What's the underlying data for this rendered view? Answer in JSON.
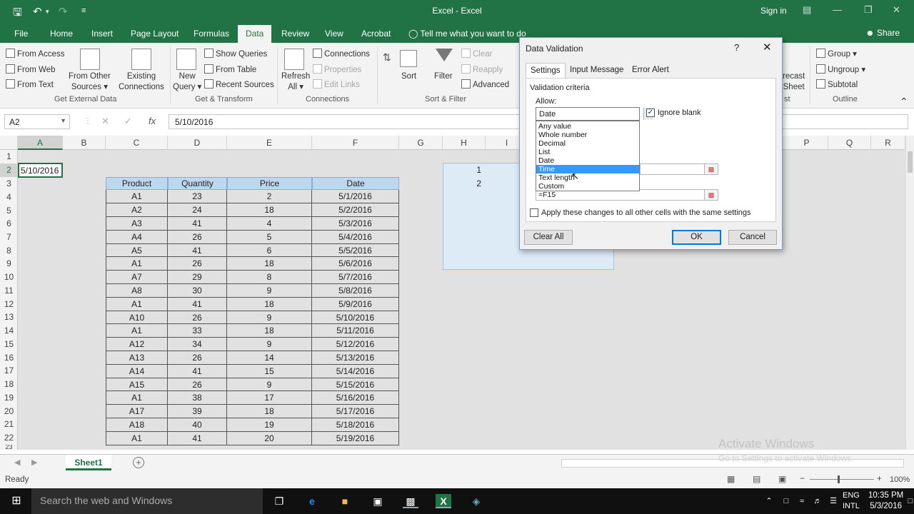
{
  "window": {
    "title": "Excel - Excel",
    "sign_in": "Sign in"
  },
  "ribbon_tabs": [
    "File",
    "Home",
    "Insert",
    "Page Layout",
    "Formulas",
    "Data",
    "Review",
    "View",
    "Acrobat"
  ],
  "tell_me": "Tell me what you want to do",
  "share": "Share",
  "ribbon": {
    "get_external": {
      "from_access": "From Access",
      "from_web": "From Web",
      "from_text": "From Text",
      "from_other": "From Other",
      "from_other_2": "Sources",
      "existing": "Existing",
      "existing_2": "Connections",
      "label": "Get External Data"
    },
    "get_transform": {
      "new_query": "New",
      "new_query_2": "Query",
      "show_queries": "Show Queries",
      "from_table": "From Table",
      "recent_sources": "Recent Sources",
      "label": "Get & Transform"
    },
    "connections": {
      "refresh": "Refresh",
      "refresh_2": "All",
      "connections": "Connections",
      "properties": "Properties",
      "edit_links": "Edit Links",
      "label": "Connections"
    },
    "sort_filter": {
      "sort": "Sort",
      "filter": "Filter",
      "clear": "Clear",
      "reapply": "Reapply",
      "advanced": "Advanced",
      "label": "Sort & Filter"
    },
    "forecast": {
      "line1": "recast",
      "line2": "Sheet",
      "label": "st"
    },
    "outline": {
      "group": "Group",
      "ungroup": "Ungroup",
      "subtotal": "Subtotal",
      "label": "Outline"
    }
  },
  "formula_bar": {
    "name_box": "A2",
    "fx": "fx",
    "formula": "5/10/2016"
  },
  "columns": [
    "A",
    "B",
    "C",
    "D",
    "E",
    "F",
    "G",
    "H",
    "I",
    "P",
    "Q",
    "R"
  ],
  "rows": [
    "1",
    "2",
    "3",
    "4",
    "5",
    "6",
    "7",
    "8",
    "9",
    "10",
    "11",
    "12",
    "13",
    "14",
    "15",
    "16",
    "17",
    "18",
    "19",
    "20",
    "21",
    "22",
    "23"
  ],
  "cell_a2": "5/10/2016",
  "table": {
    "headers": [
      "Product",
      "Quantity",
      "Price",
      "Date"
    ],
    "rows": [
      [
        "A1",
        "23",
        "2",
        "5/1/2016"
      ],
      [
        "A2",
        "24",
        "18",
        "5/2/2016"
      ],
      [
        "A3",
        "41",
        "4",
        "5/3/2016"
      ],
      [
        "A4",
        "26",
        "5",
        "5/4/2016"
      ],
      [
        "A5",
        "41",
        "6",
        "5/5/2016"
      ],
      [
        "A1",
        "26",
        "18",
        "5/6/2016"
      ],
      [
        "A7",
        "29",
        "8",
        "5/7/2016"
      ],
      [
        "A8",
        "30",
        "9",
        "5/8/2016"
      ],
      [
        "A1",
        "41",
        "18",
        "5/9/2016"
      ],
      [
        "A10",
        "26",
        "9",
        "5/10/2016"
      ],
      [
        "A1",
        "33",
        "18",
        "5/11/2016"
      ],
      [
        "A12",
        "34",
        "9",
        "5/12/2016"
      ],
      [
        "A13",
        "26",
        "14",
        "5/13/2016"
      ],
      [
        "A14",
        "41",
        "15",
        "5/14/2016"
      ],
      [
        "A15",
        "26",
        "9",
        "5/15/2016"
      ],
      [
        "A1",
        "38",
        "17",
        "5/16/2016"
      ],
      [
        "A17",
        "39",
        "18",
        "5/17/2016"
      ],
      [
        "A18",
        "40",
        "19",
        "5/18/2016"
      ],
      [
        "A1",
        "41",
        "20",
        "5/19/2016"
      ]
    ]
  },
  "h_values": [
    "1",
    "2"
  ],
  "sheet_tab": "Sheet1",
  "status": {
    "ready": "Ready",
    "zoom": "100%"
  },
  "watermark": {
    "line1": "Activate Windows",
    "line2": "Go to Settings to activate Windows."
  },
  "taskbar": {
    "search": "Search the web and Windows",
    "lang1": "ENG",
    "lang2": "INTL",
    "time": "10:35 PM",
    "date": "5/3/2016"
  },
  "dialog": {
    "title": "Data Validation",
    "help": "?",
    "tabs": [
      "Settings",
      "Input Message",
      "Error Alert"
    ],
    "criteria": "Validation criteria",
    "allow": "Allow:",
    "allow_value": "Date",
    "ignore_blank": "Ignore blank",
    "options": [
      "Any value",
      "Whole number",
      "Decimal",
      "List",
      "Date",
      "Time",
      "Text length",
      "Custom"
    ],
    "selected_option": "Time",
    "end_ref": "=F15",
    "apply_all": "Apply these changes to all other cells with the same settings",
    "clear_all": "Clear All",
    "ok": "OK",
    "cancel": "Cancel"
  },
  "colors": {
    "excel_green": "#217346",
    "table_header": "#bdd7ee",
    "selection_blue": "#3399ff"
  }
}
